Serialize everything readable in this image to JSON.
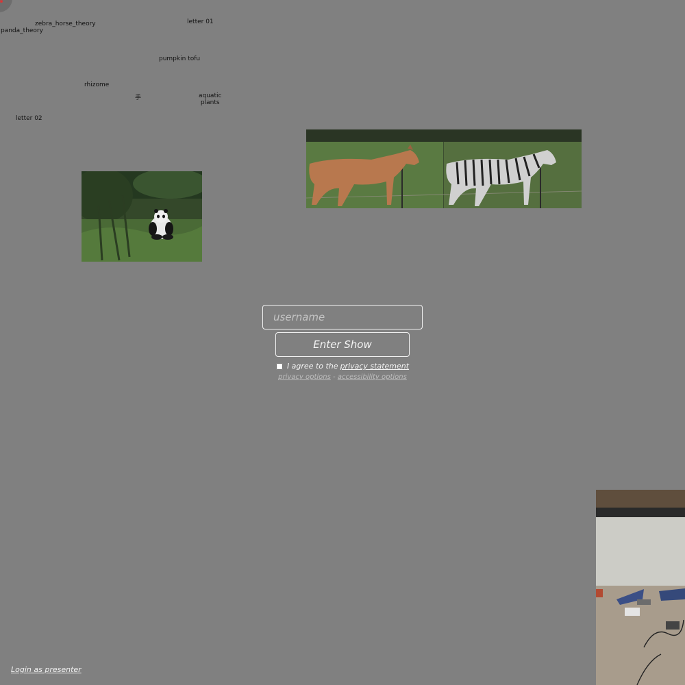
{
  "links": {
    "zebra_horse_theory": "zebra_horse_theory",
    "panda_theory": "panda_theory",
    "letter_01": "letter 01",
    "pumpkin_tofu": "pumpkin tofu",
    "rhizome": "rhizome",
    "hand": "手",
    "aquatic_plants": "aquatic\nplants",
    "letter_02": "letter 02"
  },
  "login": {
    "username_placeholder": "username",
    "enter_label": "Enter Show",
    "agree_text": "I agree to the",
    "privacy_statement": "privacy statement",
    "privacy_options": "privacy options",
    "separator": "-",
    "accessibility_options": "accessibility options"
  },
  "footer": {
    "presenter_login": "Login as presenter"
  },
  "colors": {
    "background": "#808080",
    "text_light": "#f2f2f2",
    "text_muted": "#bdbdbd",
    "accent_dot": "#d23a3a"
  }
}
